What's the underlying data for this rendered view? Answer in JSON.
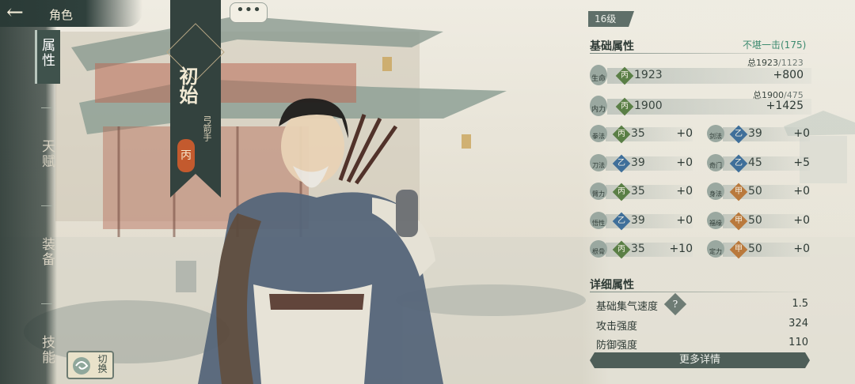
{
  "header": {
    "back_icon": "back-arrow-icon",
    "title": "角色"
  },
  "nav": {
    "items": [
      {
        "label": "属性",
        "active": true
      },
      {
        "label": "天赋",
        "active": false
      },
      {
        "label": "装备",
        "active": false
      },
      {
        "label": "技能",
        "active": false
      }
    ],
    "switch_label": "切换"
  },
  "character": {
    "name": "初始",
    "class": "弓箭手",
    "grade": "丙",
    "chat_icon": "ellipsis-icon",
    "chat_text": "•••"
  },
  "panel": {
    "level": "16级",
    "basic": {
      "title": "基础属性",
      "bonus": "不堪一击(175)",
      "hp": {
        "label": "生命",
        "rank": "丙",
        "value": "1923",
        "total_label": "总",
        "total_current": "1923",
        "total_max": "/1123",
        "bonus": "+800"
      },
      "mp": {
        "label": "内力",
        "rank": "丙",
        "value": "1900",
        "total_label": "总",
        "total_current": "1900",
        "total_max": "/475",
        "bonus": "+1425"
      },
      "stats": [
        {
          "label": "拳法",
          "rank": "丙",
          "value": "35",
          "bonus": "+0"
        },
        {
          "label": "剑法",
          "rank": "乙",
          "value": "39",
          "bonus": "+0"
        },
        {
          "label": "刀法",
          "rank": "乙",
          "value": "39",
          "bonus": "+0"
        },
        {
          "label": "奇门",
          "rank": "乙",
          "value": "45",
          "bonus": "+5"
        },
        {
          "label": "臂力",
          "rank": "丙",
          "value": "35",
          "bonus": "+0"
        },
        {
          "label": "身法",
          "rank": "甲",
          "value": "50",
          "bonus": "+0"
        },
        {
          "label": "悟性",
          "rank": "乙",
          "value": "39",
          "bonus": "+0"
        },
        {
          "label": "福缘",
          "rank": "甲",
          "value": "50",
          "bonus": "+0"
        },
        {
          "label": "根骨",
          "rank": "丙",
          "value": "35",
          "bonus": "+10"
        },
        {
          "label": "定力",
          "rank": "甲",
          "value": "50",
          "bonus": "+0"
        }
      ]
    },
    "detail": {
      "title": "详细属性",
      "rows": [
        {
          "label": "基础集气速度",
          "value": "1.5",
          "help": "?"
        },
        {
          "label": "攻击强度",
          "value": "324"
        },
        {
          "label": "防御强度",
          "value": "110"
        }
      ],
      "more_button": "更多详情"
    }
  }
}
